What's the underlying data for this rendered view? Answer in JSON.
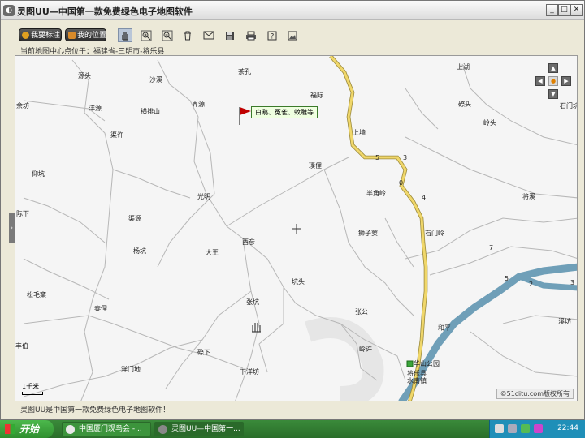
{
  "window": {
    "title": "灵图UU—中国第一款免费绿色电子地图软件",
    "controls": {
      "minimize": "_",
      "maximize": "□",
      "close": "✕"
    }
  },
  "toolbar": {
    "mark_button": "我要标注",
    "my_location_button": "我的位置",
    "tools": [
      "hand-icon",
      "zoom-in-icon",
      "zoom-out-icon",
      "delete-icon",
      "mail-icon",
      "save-icon",
      "print-icon",
      "help-icon",
      "image-icon"
    ]
  },
  "location": {
    "prefix": "当前地图中心点位于：",
    "value": "福建省-三明市-将乐县"
  },
  "map": {
    "flag_label": "白鹇、冤雀、蚊雕等",
    "places": [
      {
        "name": "上湖"
      },
      {
        "name": "茶孔"
      },
      {
        "name": "源头"
      },
      {
        "name": "沙溪"
      },
      {
        "name": "福际"
      },
      {
        "name": "余坊"
      },
      {
        "name": "洋源"
      },
      {
        "name": "横排山"
      },
      {
        "name": "界源"
      },
      {
        "name": "石门坑"
      },
      {
        "name": "磜头"
      },
      {
        "name": "岭头"
      },
      {
        "name": "渠许"
      },
      {
        "name": "上墙"
      },
      {
        "name": "仰坑"
      },
      {
        "name": "璞俚"
      },
      {
        "name": "半角岭"
      },
      {
        "name": "将溪"
      },
      {
        "name": "光明"
      },
      {
        "name": "际下"
      },
      {
        "name": "渠源"
      },
      {
        "name": "狮子窦"
      },
      {
        "name": "石门岭"
      },
      {
        "name": "西彦"
      },
      {
        "name": "杨坑"
      },
      {
        "name": "大王"
      },
      {
        "name": "坑头"
      },
      {
        "name": "松毛窠"
      },
      {
        "name": "泰俚"
      },
      {
        "name": "张坑"
      },
      {
        "name": "张公"
      },
      {
        "name": "溪坊"
      },
      {
        "name": "和平"
      },
      {
        "name": "丰伯"
      },
      {
        "name": "岭许"
      },
      {
        "name": "华山公园"
      },
      {
        "name": "磜下"
      },
      {
        "name": "洋门地"
      },
      {
        "name": "下洋坊"
      },
      {
        "name": "将乐县"
      },
      {
        "name": "水南镇"
      }
    ],
    "road_numbers": [
      "5",
      "3",
      "0",
      "4",
      "7",
      "5",
      "2",
      "3"
    ],
    "scale": "1千米",
    "copyright": "©51ditu.com版权所有"
  },
  "statusbar": "灵图UU是中国第一款免费绿色电子地图软件！",
  "taskbar": {
    "start": "开始",
    "tasks": [
      "中国厦门观鸟会 -...",
      "灵图UU—中国第一..."
    ],
    "clock": "22:44"
  },
  "colors": {
    "river": "#6f9fb8",
    "highway": "#f0d76a",
    "flag": "#c00000"
  }
}
